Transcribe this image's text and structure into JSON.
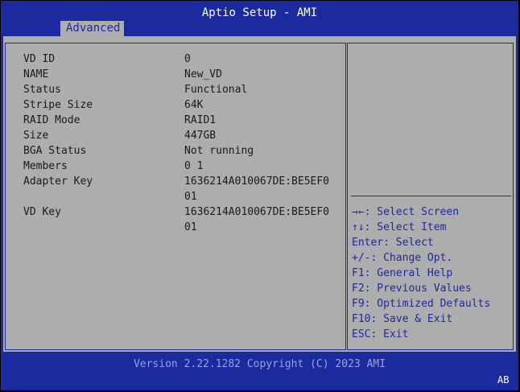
{
  "header": {
    "title": "Aptio Setup - AMI"
  },
  "tabs": [
    {
      "label": "Advanced"
    }
  ],
  "details": [
    {
      "label": "VD ID",
      "value": "0"
    },
    {
      "label": "NAME",
      "value": "New_VD"
    },
    {
      "label": "Status",
      "value": "Functional"
    },
    {
      "label": "Stripe Size",
      "value": "64K"
    },
    {
      "label": "RAID Mode",
      "value": "RAID1"
    },
    {
      "label": "Size",
      "value": "447GB"
    },
    {
      "label": "BGA Status",
      "value": "Not running"
    },
    {
      "label": "Members",
      "value": "0 1"
    },
    {
      "label": "Adapter Key",
      "value": "1636214A010067DE:BE5EF0"
    },
    {
      "label": "",
      "value": "01"
    },
    {
      "label": "VD Key",
      "value": "1636214A010067DE:BE5EF0"
    },
    {
      "label": "",
      "value": "01"
    }
  ],
  "help": [
    "→←: Select Screen",
    "↑↓: Select Item",
    "Enter: Select",
    "+/-: Change Opt.",
    "F1: General Help",
    "F2: Previous Values",
    "F9: Optimized Defaults",
    "F10: Save & Exit",
    "ESC: Exit"
  ],
  "footer": {
    "version": "Version 2.22.1282 Copyright (C) 2023 AMI",
    "badge": "AB"
  },
  "colors": {
    "frame": "#1c2aa0",
    "panel": "#adadad",
    "text": "#1a1a1a"
  }
}
